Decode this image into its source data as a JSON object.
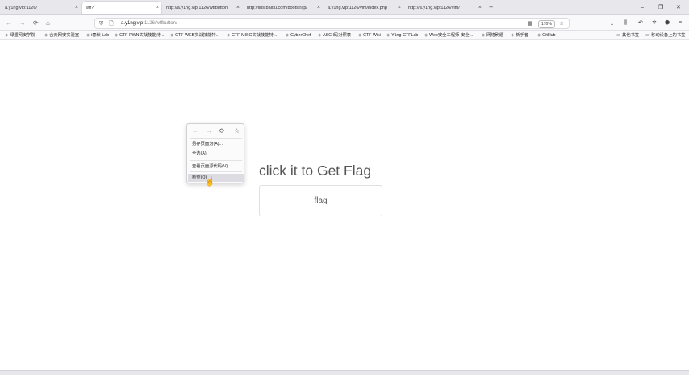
{
  "tabs": [
    {
      "title": "a.y1ng.vip:1126/",
      "active": false
    },
    {
      "title": "wtf?",
      "active": true
    },
    {
      "title": "http://a.y1ng.vip:1126/wtfbutton",
      "active": false
    },
    {
      "title": "http://libs.baidu.com/bootstrap/",
      "active": false
    },
    {
      "title": "a.y1ng.vip:1126/vim/index.php",
      "active": false
    },
    {
      "title": "http://a.y1ng.vip:1126/vim/",
      "active": false
    }
  ],
  "new_tab_label": "+",
  "window_controls": {
    "minimize": "–",
    "maximize": "❐",
    "close": "✕"
  },
  "nav": {
    "back": "←",
    "forward": "→",
    "reload": "⟳",
    "home": "⌂"
  },
  "url": {
    "host": "a.y1ng.vip",
    "path": ":1126/wtfbutton/"
  },
  "zoom_level": "170%",
  "icons": {
    "tab_close": "close-icon",
    "shield": "shield-icon",
    "page_info": "page-info-icon",
    "qr": "qr-icon",
    "star": "star-icon",
    "download": "download-icon",
    "library": "library-icon",
    "undo": "undo-icon",
    "extension": "extension-icon",
    "hexagon": "addon-icon",
    "menu": "hamburger-menu-icon"
  },
  "bookmarks": [
    "绿盟网安学院",
    "合天网安实验室",
    "i春秋 Lab",
    "CTF-PWN实战技能特...",
    "CTF-WEB实战技能特...",
    "CTF-MISC实战技能特...",
    "CyberChef",
    "ASCII码对照表",
    "CTF Wiki",
    "Y1ng-CTFLab",
    "Web安全工程师-安全...",
    "网络刷题",
    "新手者",
    "GitHub"
  ],
  "bookmarks_right": [
    "其他书签",
    "移动设备上的书签"
  ],
  "page": {
    "heading": "click it to Get Flag",
    "button_label": "flag"
  },
  "context_menu": {
    "items": [
      "另存页面为(A)...",
      "全选(A)",
      "查看页面源代码(V)",
      "检查(Q)"
    ],
    "hovered_index": 3
  },
  "colors": {
    "tab_bar": "#e8e8ec",
    "toolbar": "#f9f9fb",
    "page_bg": "#ffffff",
    "heading_text": "#555555",
    "menu_hover": "#dcdce2"
  }
}
